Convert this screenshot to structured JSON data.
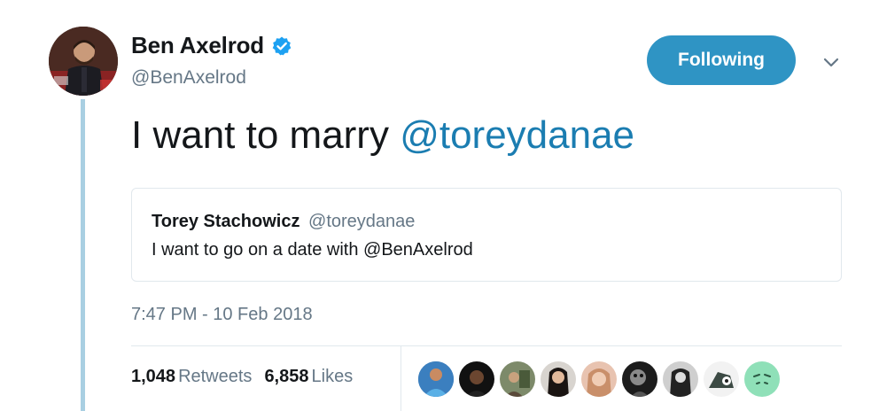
{
  "tweet": {
    "author": {
      "display_name": "Ben Axelrod",
      "handle": "@BenAxelrod",
      "verified": true
    },
    "follow_button_label": "Following",
    "text_prefix": "I want to marry ",
    "text_mention": "@toreydanae",
    "quoted_tweet": {
      "display_name": "Torey Stachowicz",
      "handle": "@toreydanae",
      "text": "I want to go on a date with @BenAxelrod"
    },
    "timestamp": "7:47 PM - 10 Feb 2018",
    "stats": {
      "retweets_count": "1,048",
      "retweets_label": "Retweets",
      "likes_count": "6,858",
      "likes_label": "Likes"
    },
    "liker_avatars": [
      "liker-1",
      "liker-2",
      "liker-3",
      "liker-4",
      "liker-5",
      "liker-6",
      "liker-7",
      "liker-8",
      "liker-9"
    ]
  },
  "colors": {
    "link": "#1b7db1",
    "button": "#2f94c4",
    "secondary_text": "#657786",
    "thread_line": "#a9cfe2",
    "verified": "#1da1f2"
  },
  "icons": {
    "verified": "verified-badge-icon",
    "caret": "chevron-down-icon"
  }
}
